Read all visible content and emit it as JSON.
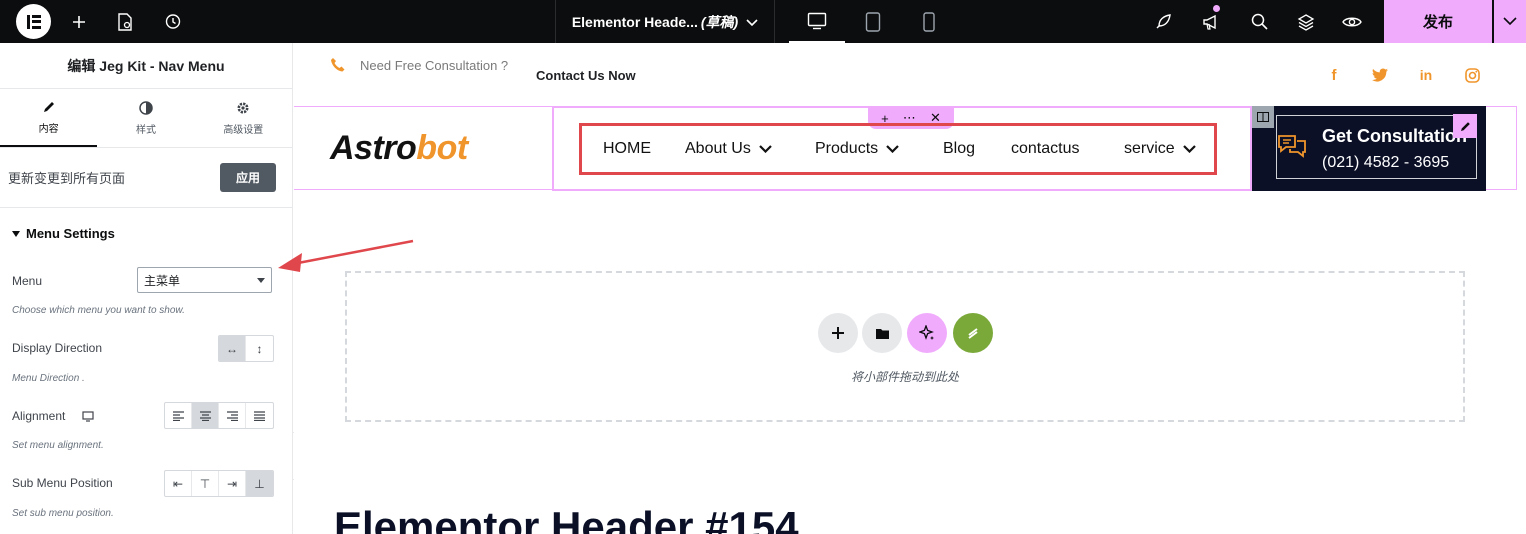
{
  "topbar": {
    "title": "Elementor Heade...",
    "draft": "(草稿)",
    "publish": "发布",
    "icons": [
      "elementor-logo",
      "add-icon",
      "page-settings-icon",
      "history-icon",
      "desktop-icon",
      "tablet-icon",
      "mobile-icon",
      "rocket-icon",
      "megaphone-icon",
      "search-icon",
      "layers-icon",
      "preview-eye-icon",
      "chevron-down-icon"
    ]
  },
  "panel": {
    "title": "编辑 Jeg Kit - Nav Menu",
    "tabs": [
      {
        "label": "内容",
        "icon": "pencil-icon"
      },
      {
        "label": "样式",
        "icon": "contrast-icon"
      },
      {
        "label": "高级设置",
        "icon": "gear-icon"
      }
    ],
    "apply_text": "更新变更到所有页面",
    "apply_button": "应用",
    "section": "Menu Settings",
    "menu_label": "Menu",
    "menu_value": "主菜单",
    "menu_help": "Choose which menu you want to show.",
    "direction_label": "Display Direction",
    "direction_help": "Menu Direction .",
    "alignment_label": "Alignment",
    "alignment_help": "Set menu alignment.",
    "submenu_label": "Sub Menu Position",
    "submenu_help": "Set sub menu position."
  },
  "preview": {
    "consult": "Need Free Consultation ?",
    "contact": "Contact Us Now",
    "social": [
      "f",
      "t",
      "in",
      "ig"
    ],
    "logo_a": "Astro",
    "logo_b": "bot",
    "nav": [
      {
        "label": "HOME",
        "dropdown": false
      },
      {
        "label": "About Us",
        "dropdown": true
      },
      {
        "label": "Products",
        "dropdown": true
      },
      {
        "label": "Blog",
        "dropdown": false
      },
      {
        "label": "contactus",
        "dropdown": false
      },
      {
        "label": "service",
        "dropdown": true
      }
    ],
    "cta_title": "Get Consultation",
    "cta_phone": "(021) 4582 - 3695",
    "dropzone_text": "将小部件拖动到此处",
    "page_title": "Elementor Header #154"
  },
  "colors": {
    "accent_pink": "#f0abfc",
    "brand_orange": "#f0952b",
    "highlight_red": "#e0474c",
    "cta_navy": "#0b1027"
  }
}
